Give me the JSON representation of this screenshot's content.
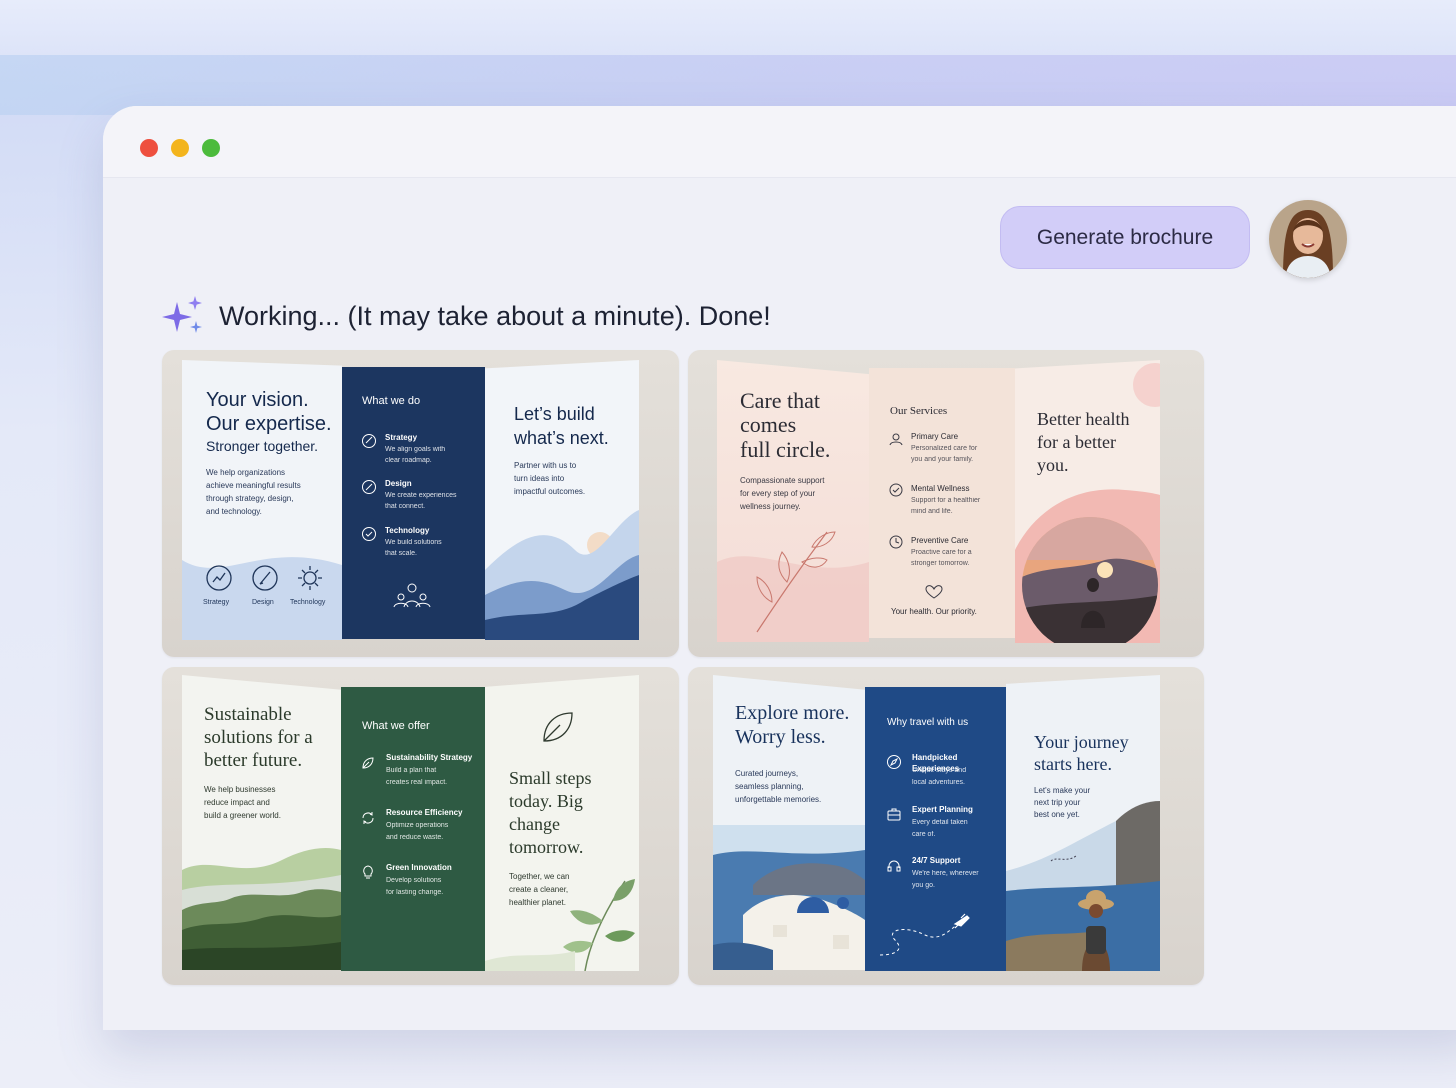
{
  "window": {
    "controls": [
      "close",
      "minimize",
      "maximize"
    ]
  },
  "chat": {
    "button_label": "Generate brochure",
    "avatar_icon": "user-avatar",
    "status_icon": "sparkle-icon",
    "status_text": "Working... (It may take about a minute). Done!"
  },
  "brochures": [
    {
      "theme": "business",
      "left_headline_1": "Your vision.",
      "left_headline_2": "Our expertise.",
      "left_headline_3": "Stronger together.",
      "left_body_1": "We help organizations",
      "left_body_2": "achieve meaningful results",
      "left_body_3": "through strategy, design,",
      "left_body_4": "and technology.",
      "icon_labels": [
        "Strategy",
        "Design",
        "Technology"
      ],
      "middle_title": "What we do",
      "items": [
        {
          "title": "Strategy",
          "line1": "We align goals with",
          "line2": "clear roadmap."
        },
        {
          "title": "Design",
          "line1": "We create experiences",
          "line2": "that connect."
        },
        {
          "title": "Technology",
          "line1": "We build solutions",
          "line2": "that scale."
        }
      ],
      "right_headline_1": "Let’s build",
      "right_headline_2": "what’s next.",
      "right_body_1": "Partner with us to",
      "right_body_2": "turn ideas into",
      "right_body_3": "impactful outcomes."
    },
    {
      "theme": "health",
      "left_headline_1": "Care that",
      "left_headline_2": "comes",
      "left_headline_3": "full circle.",
      "left_body_1": "Compassionate support",
      "left_body_2": "for every step of your",
      "left_body_3": "wellness journey.",
      "middle_title": "Our Services",
      "items": [
        {
          "title": "Primary Care",
          "line1": "Personalized care for",
          "line2": "you and your family."
        },
        {
          "title": "Mental Wellness",
          "line1": "Support for a healthier",
          "line2": "mind and life."
        },
        {
          "title": "Preventive Care",
          "line1": "Proactive care for a",
          "line2": "stronger tomorrow."
        }
      ],
      "middle_footer": "Your health. Our priority.",
      "right_headline_1": "Better health",
      "right_headline_2": "for a better",
      "right_headline_3": "you."
    },
    {
      "theme": "sustainability",
      "left_headline_1": "Sustainable",
      "left_headline_2": "solutions for a",
      "left_headline_3": "better future.",
      "left_body_1": "We help businesses",
      "left_body_2": "reduce impact and",
      "left_body_3": "build a greener world.",
      "middle_title": "What we offer",
      "items": [
        {
          "title": "Sustainability Strategy",
          "line1": "Build a plan that",
          "line2": "creates real impact."
        },
        {
          "title": "Resource Efficiency",
          "line1": "Optimize operations",
          "line2": "and reduce waste."
        },
        {
          "title": "Green Innovation",
          "line1": "Develop solutions",
          "line2": "for lasting change."
        }
      ],
      "right_headline_1": "Small steps",
      "right_headline_2": "today. Big",
      "right_headline_3": "change",
      "right_headline_4": "tomorrow.",
      "right_body_1": "Together, we can",
      "right_body_2": "create a cleaner,",
      "right_body_3": "healthier planet."
    },
    {
      "theme": "travel",
      "left_headline_1": "Explore more.",
      "left_headline_2": "Worry less.",
      "left_body_1": "Curated journeys,",
      "left_body_2": "seamless planning,",
      "left_body_3": "unforgettable memories.",
      "middle_title": "Why travel with us",
      "items": [
        {
          "title": "Handpicked Experiences",
          "line1": "Unique stays and",
          "line2": "local adventures."
        },
        {
          "title": "Expert Planning",
          "line1": "Every detail taken",
          "line2": "care of."
        },
        {
          "title": "24/7 Support",
          "line1": "We're here, wherever",
          "line2": "you go."
        }
      ],
      "right_headline_1": "Your journey",
      "right_headline_2": "starts here.",
      "right_body_1": "Let's make your",
      "right_body_2": "next trip your",
      "right_body_3": "best one yet."
    }
  ]
}
